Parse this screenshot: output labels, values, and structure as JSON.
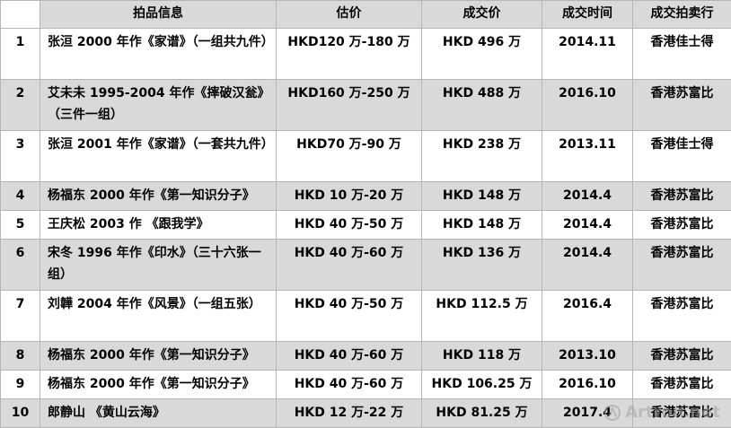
{
  "table": {
    "headers": [
      "",
      "拍品信息",
      "估价",
      "成交价",
      "成交时间",
      "成交拍卖行"
    ],
    "rows": [
      [
        "1",
        "张洹 2000 年作《家谱》（一组共九件）",
        "HKD120 万-180 万",
        "HKD 496 万",
        "2014.11",
        "香港佳士得"
      ],
      [
        "2",
        "艾未未 1995-2004 年作《摔破汉瓮》（三件一组）",
        "HKD160 万-250 万",
        "HKD 488 万",
        "2016.10",
        "香港苏富比"
      ],
      [
        "3",
        "张洹 2001 年作《家谱》（一套共九件）",
        "HKD70 万-90 万",
        "HKD 238 万",
        "2013.11",
        "香港佳士得"
      ],
      [
        "4",
        "杨福东 2000 年作《第一知识分子》",
        "HKD 10 万-20 万",
        "HKD 148 万",
        "2014.4",
        "香港苏富比"
      ],
      [
        "5",
        "王庆松 2003 作 《跟我学》",
        "HKD 40 万-50 万",
        "HKD 148 万",
        "2014.4",
        "香港苏富比"
      ],
      [
        "6",
        "宋冬 1996 年作《印水》（三十六张一组）",
        "HKD 40 万-60 万",
        "HKD 136 万",
        "2014.4",
        "香港苏富比"
      ],
      [
        "7",
        "刘韡 2004 年作《风景》（一组五张）",
        "HKD 40 万-50 万",
        "HKD 112.5 万",
        "2016.4",
        "香港苏富比"
      ],
      [
        "8",
        "杨福东 2000 年作《第一知识分子》",
        "HKD 40 万-60 万",
        "HKD 118 万",
        "2013.10",
        "香港苏富比"
      ],
      [
        "9",
        "杨福东 2000 年作《第一知识分子》",
        "HKD 40 万-60 万",
        "HKD 106.25 万",
        "2016.10",
        "香港苏富比"
      ],
      [
        "10",
        "郎静山 《黄山云海》",
        "HKD 12 万-22 万",
        "HKD 81.25 万",
        "2017.4",
        "香港苏富比"
      ]
    ]
  },
  "watermark": {
    "text": "Artron.net",
    "icon": "artron-logo-icon"
  }
}
